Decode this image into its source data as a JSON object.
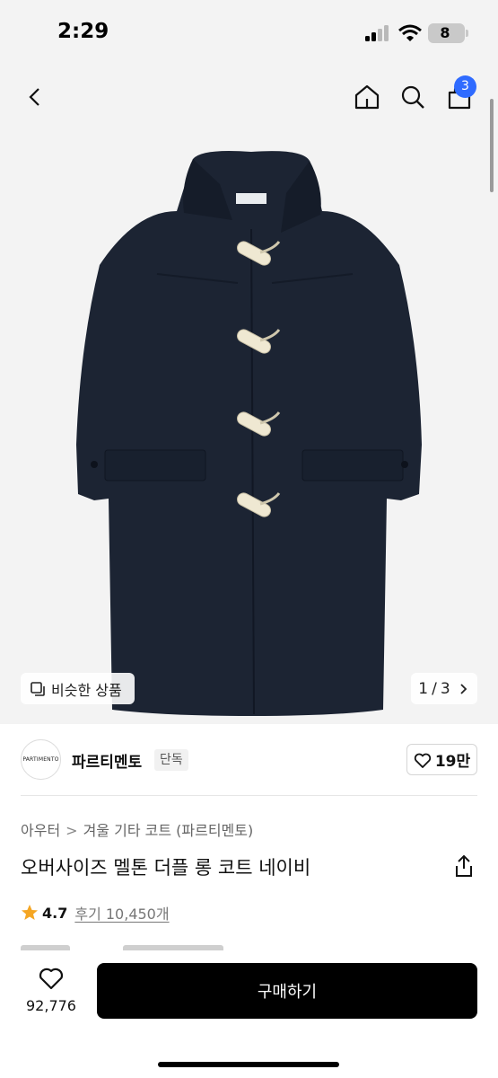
{
  "status": {
    "time": "2:29",
    "battery": "8"
  },
  "header": {
    "cart_count": "3",
    "icons": [
      "back-icon",
      "home-icon",
      "search-icon",
      "cart-icon"
    ]
  },
  "gallery": {
    "similar_label": "비슷한 상품",
    "current_page": "1",
    "separator": "/",
    "total_pages": "3"
  },
  "brand": {
    "logo_text": "PARTIMENTO",
    "name": "파르티멘토",
    "tag": "단독",
    "likes": "19만"
  },
  "product": {
    "breadcrumb": [
      "아우터",
      "겨울 기타 코트 (파르티멘토)"
    ],
    "breadcrumb_separator": ">",
    "title": "오버사이즈 멜톤 더플 롱 코트 네이비",
    "rating": "4.7",
    "reviews": "후기 10,450개"
  },
  "bottom": {
    "wish_count": "92,776",
    "buy_label": "구매하기"
  },
  "colors": {
    "accent": "#2f6bff",
    "coat": "#1c2433",
    "toggle": "#efe8d2",
    "star": "#f5a623",
    "buy_button": "#000000"
  }
}
